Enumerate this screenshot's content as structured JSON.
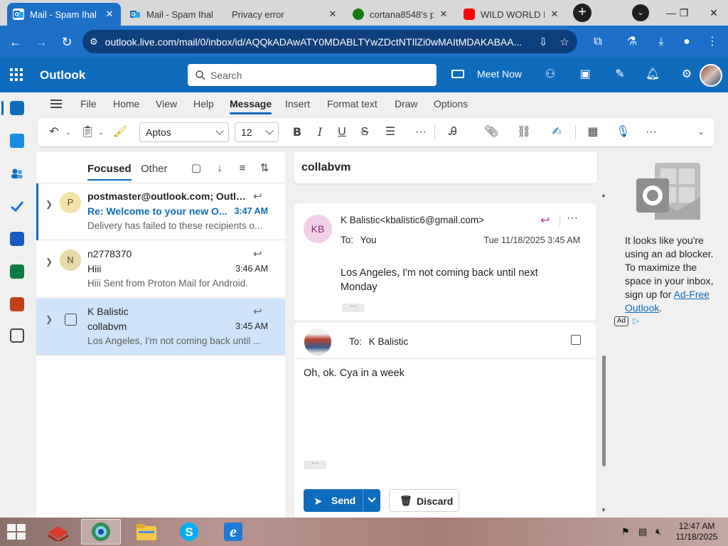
{
  "browser": {
    "tabs": [
      {
        "title": "Mail - Spam Ihal",
        "active": true
      },
      {
        "title": "Mail - Spam Ihal",
        "active": false
      },
      {
        "title": "Privacy error",
        "active": false
      },
      {
        "title": "cortana8548's p",
        "active": false
      },
      {
        "title": "WILD WORLD D",
        "active": false
      }
    ],
    "new_tab": "+",
    "url": "outlook.live.com/mail/0/inbox/id/AQQkADAwATY0MDABLTYwZDctNTIlZi0wMAItMDAKABAA..."
  },
  "outlook": {
    "app_name": "Outlook",
    "search_placeholder": "Search",
    "meet_now": "Meet Now",
    "menu_tabs": [
      "File",
      "Home",
      "View",
      "Help",
      "Message",
      "Insert",
      "Format text",
      "Draw",
      "Options"
    ],
    "active_menu_tab": "Message",
    "font_name": "Aptos",
    "font_size": "12",
    "accent": "#0f6cbd"
  },
  "message_list": {
    "pivots": {
      "focused": "Focused",
      "other": "Other"
    },
    "items": [
      {
        "initial": "P",
        "sender": "postmaster@outlook.com; Outlo...",
        "subject": "Re: Welcome to your new O...",
        "time": "3:47 AM",
        "preview": "Delivery has failed to these recipients o...",
        "unread": true,
        "avatar_color": "#f4e3a6"
      },
      {
        "initial": "N",
        "sender": "n2778370",
        "subject": "Hiii",
        "time": "3:46 AM",
        "preview": "Hiii Sent from Proton Mail for Android.",
        "unread": false,
        "avatar_color": "#e8d9a8"
      },
      {
        "initial": "",
        "sender": "K Balistic",
        "subject": "collabvm",
        "time": "3:45 AM",
        "preview": "Los Angeles, I'm not coming back until ...",
        "unread": false,
        "selected": true
      }
    ]
  },
  "reading_pane": {
    "subject": "collabvm",
    "message": {
      "initials": "KB",
      "from": "K Balistic<kbalistic6@gmail.com>",
      "to_label": "To:",
      "to": "You",
      "date": "Tue 11/18/2025 3:45 AM",
      "body": "Los Angeles, I'm not coming back until next Monday"
    },
    "compose": {
      "to_label": "To:",
      "to": "K Balistic",
      "body": "Oh, ok. Cya in a week",
      "send": "Send",
      "discard": "Discard"
    }
  },
  "ad_pane": {
    "text_before": "It looks like you're using an ad blocker. To maximize the space in your inbox, sign up for ",
    "link": "Ad-Free Outlook",
    "text_after": ".",
    "badge": "Ad"
  },
  "taskbar": {
    "time": "12:47 AM",
    "date": "11/18/2025"
  }
}
